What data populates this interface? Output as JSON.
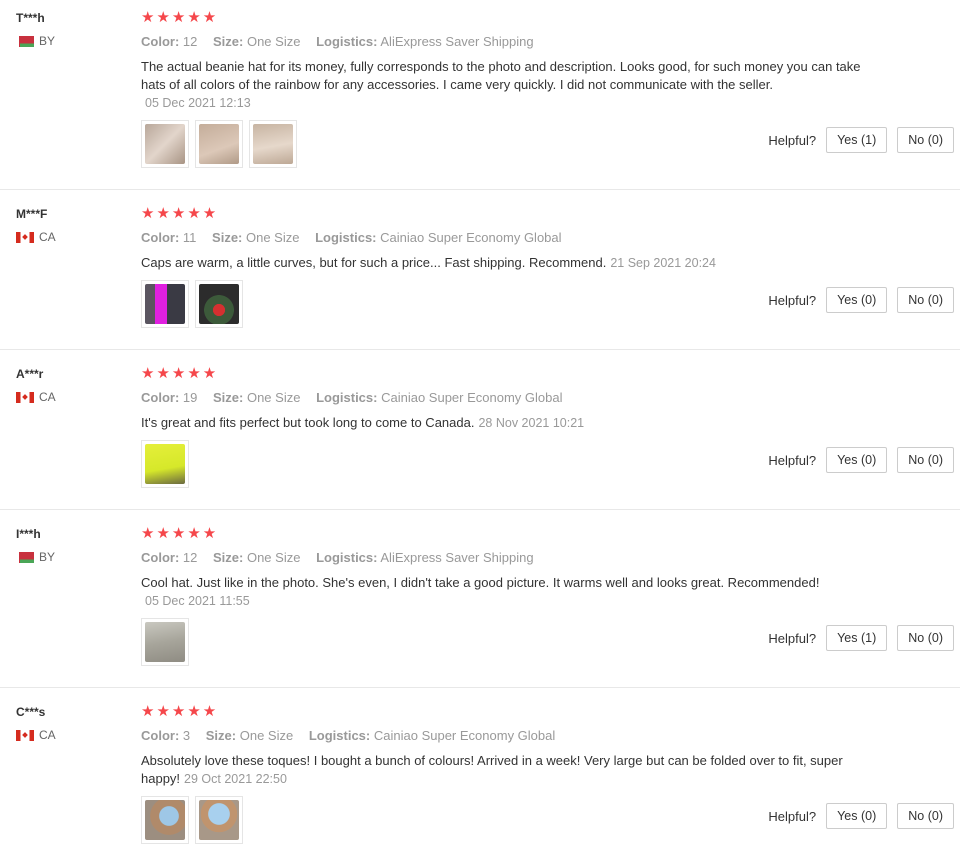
{
  "labels": {
    "color": "Color:",
    "size": "Size:",
    "logistics": "Logistics:",
    "helpful": "Helpful?"
  },
  "star_icon": "★★★★★",
  "reviews": [
    {
      "user": "T***h",
      "country": "BY",
      "flag": "by",
      "rating": 5,
      "color": "12",
      "size": "One Size",
      "logistics": "AliExpress Saver Shipping",
      "text": "The actual beanie hat for its money, fully corresponds to the photo and description. Looks good, for such money you can take hats of all colors of the rainbow for any accessories. I came very quickly. I did not communicate with the seller.",
      "date": "05 Dec 2021 12:13",
      "yes": "Yes (1)",
      "no": "No (0)"
    },
    {
      "user": "M***F",
      "country": "CA",
      "flag": "ca",
      "rating": 5,
      "color": "11",
      "size": "One Size",
      "logistics": "Cainiao Super Economy Global",
      "text": "Caps are warm, a little curves, but for such a price... Fast shipping. Recommend.",
      "date": "21 Sep 2021 20:24",
      "yes": "Yes (0)",
      "no": "No (0)"
    },
    {
      "user": "A***r",
      "country": "CA",
      "flag": "ca",
      "rating": 5,
      "color": "19",
      "size": "One Size",
      "logistics": "Cainiao Super Economy Global",
      "text": "It's great and fits perfect but took long to come to Canada.",
      "date": "28 Nov 2021 10:21",
      "yes": "Yes (0)",
      "no": "No (0)"
    },
    {
      "user": "I***h",
      "country": "BY",
      "flag": "by",
      "rating": 5,
      "color": "12",
      "size": "One Size",
      "logistics": "AliExpress Saver Shipping",
      "text": "Cool hat. Just like in the photo. She's even, I didn't take a good picture. It warms well and looks great. Recommended!",
      "date": "05 Dec 2021 11:55",
      "yes": "Yes (1)",
      "no": "No (0)"
    },
    {
      "user": "C***s",
      "country": "CA",
      "flag": "ca",
      "rating": 5,
      "color": "3",
      "size": "One Size",
      "logistics": "Cainiao Super Economy Global",
      "text": "Absolutely love these toques! I bought a bunch of colours! Arrived in a week! Very large but can be folded over to fit, super happy!",
      "date": "29 Oct 2021 22:50",
      "yes": "Yes (0)",
      "no": "No (0)"
    }
  ]
}
